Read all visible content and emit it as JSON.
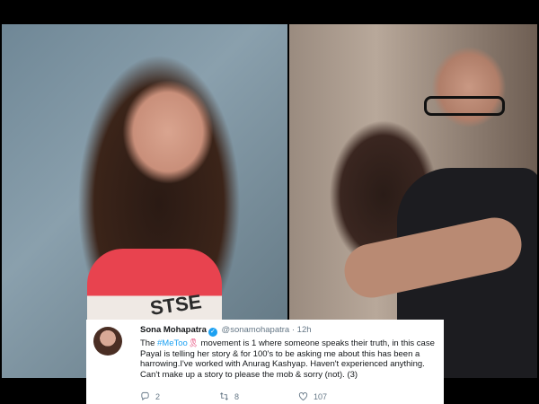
{
  "tweet": {
    "display_name": "Sona Mohapatra",
    "handle": "@sonamohapatra",
    "separator": "·",
    "time": "12h",
    "text_before_hashtag": "The ",
    "hashtag": "#MeToo",
    "text_after_hashtag": " movement is 1 where someone speaks their truth, in this case Payal is telling her story & for 100's to be asking me about this has been a harrowing.I've worked with Anurag Kashyap. Haven't experienced anything. Can't make up a story to please the mob & sorry (not). (3)",
    "replies": "2",
    "retweets": "8",
    "likes": "107"
  },
  "left_photo": {
    "shirt_text": "STSE"
  },
  "icons": [
    "verified-icon",
    "ribbon-emoji-icon",
    "reply-icon",
    "retweet-icon",
    "like-icon"
  ],
  "colors": {
    "link": "#1da1f2",
    "text": "#14171a",
    "muted": "#657786",
    "background": "#000000"
  }
}
